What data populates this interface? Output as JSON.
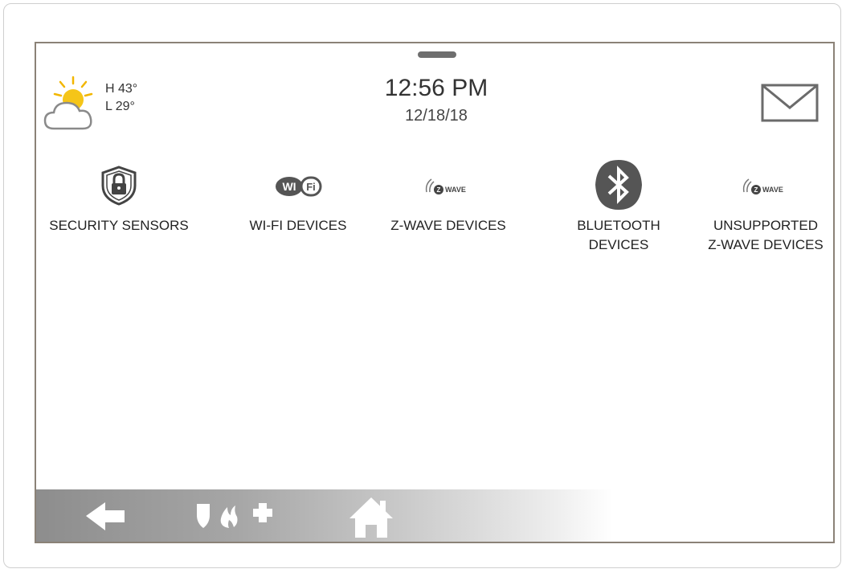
{
  "weather": {
    "high": "H 43°",
    "low": "L 29°",
    "icon": "partly-sunny-icon"
  },
  "clock": {
    "time": "12:56 PM",
    "date": "12/18/18"
  },
  "header": {
    "messages_icon": "envelope-icon"
  },
  "tiles": [
    {
      "label": "SECURITY SENSORS",
      "icon": "shield-lock-icon"
    },
    {
      "label": "WI-FI DEVICES",
      "icon": "wifi-logo-icon"
    },
    {
      "label": "Z-WAVE DEVICES",
      "icon": "zwave-logo-icon"
    },
    {
      "label": "BLUETOOTH\nDEVICES",
      "icon": "bluetooth-icon"
    },
    {
      "label": "UNSUPPORTED\nZ-WAVE DEVICES",
      "icon": "zwave-logo-icon"
    }
  ],
  "bottom_bar": {
    "back_icon": "back-arrow-icon",
    "emergency_icons": [
      "shield-icon",
      "flame-icon",
      "medical-cross-icon"
    ],
    "home_icon": "home-icon"
  },
  "colors": {
    "screen_border": "#8b8277",
    "icon_gray": "#555555",
    "text": "#222222"
  }
}
